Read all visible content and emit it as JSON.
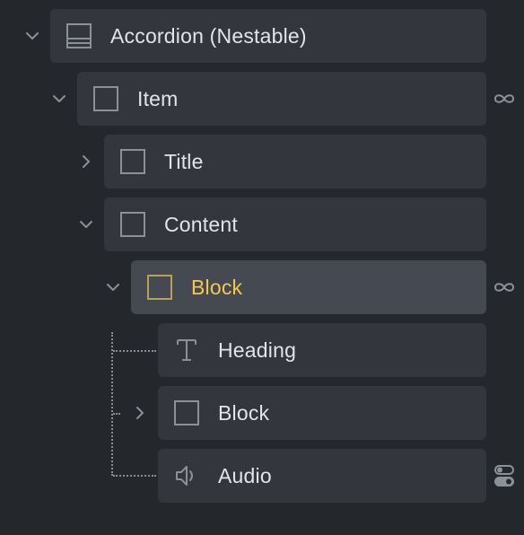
{
  "tree": {
    "nodes": [
      {
        "label": "Accordion (Nestable)",
        "icon": "accordion-layout-icon",
        "toggle": "chevron-down-icon"
      },
      {
        "label": "Item",
        "icon": "square-outline-icon",
        "toggle": "chevron-down-icon",
        "badge": "infinity-icon"
      },
      {
        "label": "Title",
        "icon": "square-outline-icon",
        "toggle": "chevron-right-icon"
      },
      {
        "label": "Content",
        "icon": "square-outline-icon",
        "toggle": "chevron-down-icon"
      },
      {
        "label": "Block",
        "icon": "square-outline-icon",
        "toggle": "chevron-down-icon",
        "badge": "infinity-icon",
        "selected": true
      },
      {
        "label": "Heading",
        "icon": "text-t-icon"
      },
      {
        "label": "Block",
        "icon": "square-outline-icon",
        "toggle": "chevron-right-icon"
      },
      {
        "label": "Audio",
        "icon": "speaker-icon",
        "badge": "toggles-icon"
      }
    ]
  },
  "colors": {
    "background": "#24272c",
    "node": "#33363c",
    "node_selected": "#454a52",
    "label": "#e2e4e8",
    "label_selected": "#f2c94c",
    "icon": "#8c9097",
    "icon_selected": "#b8a25a"
  }
}
